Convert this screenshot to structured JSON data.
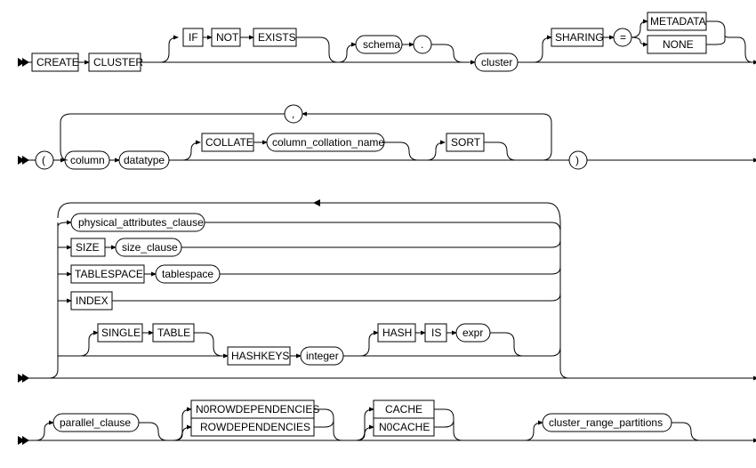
{
  "keywords": {
    "create": "CREATE",
    "cluster": "CLUSTER",
    "if": "IF",
    "not": "NOT",
    "exists": "EXISTS",
    "sharing": "SHARING",
    "equals": "=",
    "metadata": "METADATA",
    "none": "NONE",
    "collate": "COLLATE",
    "sort": "SORT",
    "size": "SIZE",
    "tablespace": "TABLESPACE",
    "index": "INDEX",
    "single": "SINGLE",
    "table": "TABLE",
    "hashkeys": "HASHKEYS",
    "hash": "HASH",
    "is": "IS",
    "norowdep": "N0ROWDEPENDENCIES",
    "rowdep": "ROWDEPENDENCIES",
    "cache": "CACHE",
    "nocache": "N0CACHE"
  },
  "nonterminals": {
    "schema": "schema",
    "cluster": "cluster",
    "column": "column",
    "datatype": "datatype",
    "column_collation_name": "column_collation_name",
    "physical_attributes_clause": "physical_attributes_clause",
    "size_clause": "size_clause",
    "tablespace": "tablespace",
    "integer": "integer",
    "expr": "expr",
    "parallel_clause": "parallel_clause",
    "cluster_range_partitions": "cluster_range_partitions"
  },
  "punctuation": {
    "dot": ".",
    "comma": ",",
    "lparen": "(",
    "rparen": ")"
  }
}
